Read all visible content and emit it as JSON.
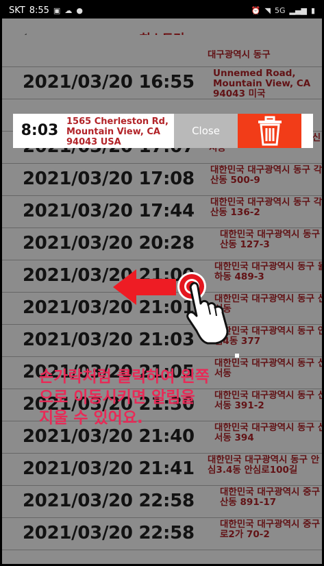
{
  "status_bar": {
    "carrier": "SKT",
    "time": "8:55",
    "network": "5G"
  },
  "header": {
    "back_icon": "chevron-left-icon",
    "title": "히스토리"
  },
  "history": [
    {
      "datetime": "",
      "address": "대구광역시 동구"
    },
    {
      "datetime": "2021/03/20 16:55",
      "address": "Unnemed Road, Mountain View, CA 94043 미국"
    },
    {
      "datetime": "",
      "address": ""
    },
    {
      "datetime": "2021/03/20 17:07",
      "address": "대한민국 대구광역시 동구 신서동"
    },
    {
      "datetime": "2021/03/20 17:08",
      "address": "대한민국 대구광역시 동구 각산동 500-9"
    },
    {
      "datetime": "2021/03/20 17:44",
      "address": "대한민국 대구광역시 동구 각산동 136-2"
    },
    {
      "datetime": "2021/03/20 20:28",
      "address": "대한민국 대구광역시 동구 각산동 127-3"
    },
    {
      "datetime": "2021/03/20 21:00",
      "address": "대한민국 대구광역시 동구 율하동 489-3"
    },
    {
      "datetime": "2021/03/20 21:01",
      "address": "대한민국 대구광역시 동구 신서동"
    },
    {
      "datetime": "2021/03/20 21:03",
      "address": "대한민국 대구광역시 동구 안심4동 377"
    },
    {
      "datetime": "2021/03/20 21:05",
      "address": "대한민국 대구광역시 동구 신서동"
    },
    {
      "datetime": "2021/03/20 21:30",
      "address": "대한민국 대구광역시 동구 신서동 391-2"
    },
    {
      "datetime": "2021/03/20 21:40",
      "address": "대한민국 대구광역시 동구 신서동 394"
    },
    {
      "datetime": "2021/03/20 21:41",
      "address": "대한민국 대구광역시 동구 안심3.4동 안심로100길"
    },
    {
      "datetime": "2021/03/20 22:58",
      "address": "대한민국 대구광역시 중구 남산동 891-17"
    },
    {
      "datetime": "2021/03/20 22:58",
      "address": "대한민국 대구광역시 중구 종로2가 70-2"
    }
  ],
  "swipe_demo": {
    "time": "8:03",
    "address": "1565 Cherleston Rd, Mountain View, CA 94043 USA",
    "close_label": "Close",
    "delete_icon": "trash-icon",
    "delete_color": "#f23c18"
  },
  "instruction": {
    "lines": [
      "손가락처럼 클릭하여 왼쪽",
      "으로 이동시키면 알림을",
      "지울 수 있어요."
    ],
    "color": "#e82a57"
  },
  "gesture": {
    "arrow_icon": "left-arrow-icon",
    "hand_icon": "pointing-hand-icon"
  }
}
